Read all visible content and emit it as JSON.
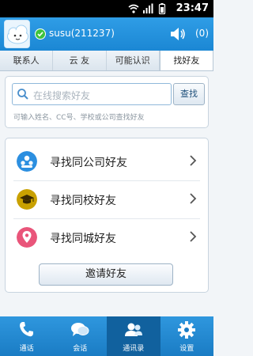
{
  "status_bar": {
    "time": "23:47"
  },
  "header": {
    "username": "susu(211237)",
    "mute_count": "(0)"
  },
  "tabs": [
    {
      "label": "联系人",
      "active": false
    },
    {
      "label": "云 友",
      "active": false
    },
    {
      "label": "可能认识",
      "active": false
    },
    {
      "label": "找好友",
      "active": true
    }
  ],
  "search": {
    "placeholder": "在线搜索好友",
    "button_label": "查找",
    "hint": "可输入姓名、CC号、学校或公司查找好友"
  },
  "options": [
    {
      "label": "寻找同公司好友",
      "icon": "company-icon",
      "color": "#2c8fe0"
    },
    {
      "label": "寻找同校好友",
      "icon": "graduation-cap-icon",
      "color": "#c9a100"
    },
    {
      "label": "寻找同城好友",
      "icon": "location-pin-icon",
      "color": "#e9557a"
    }
  ],
  "invite_button": "邀请好友",
  "bottom_nav": [
    {
      "label": "通话",
      "icon": "phone-icon",
      "active": false
    },
    {
      "label": "会话",
      "icon": "chat-icon",
      "active": false
    },
    {
      "label": "通讯录",
      "icon": "contacts-icon",
      "active": true
    },
    {
      "label": "设置",
      "icon": "gear-icon",
      "active": false
    }
  ]
}
